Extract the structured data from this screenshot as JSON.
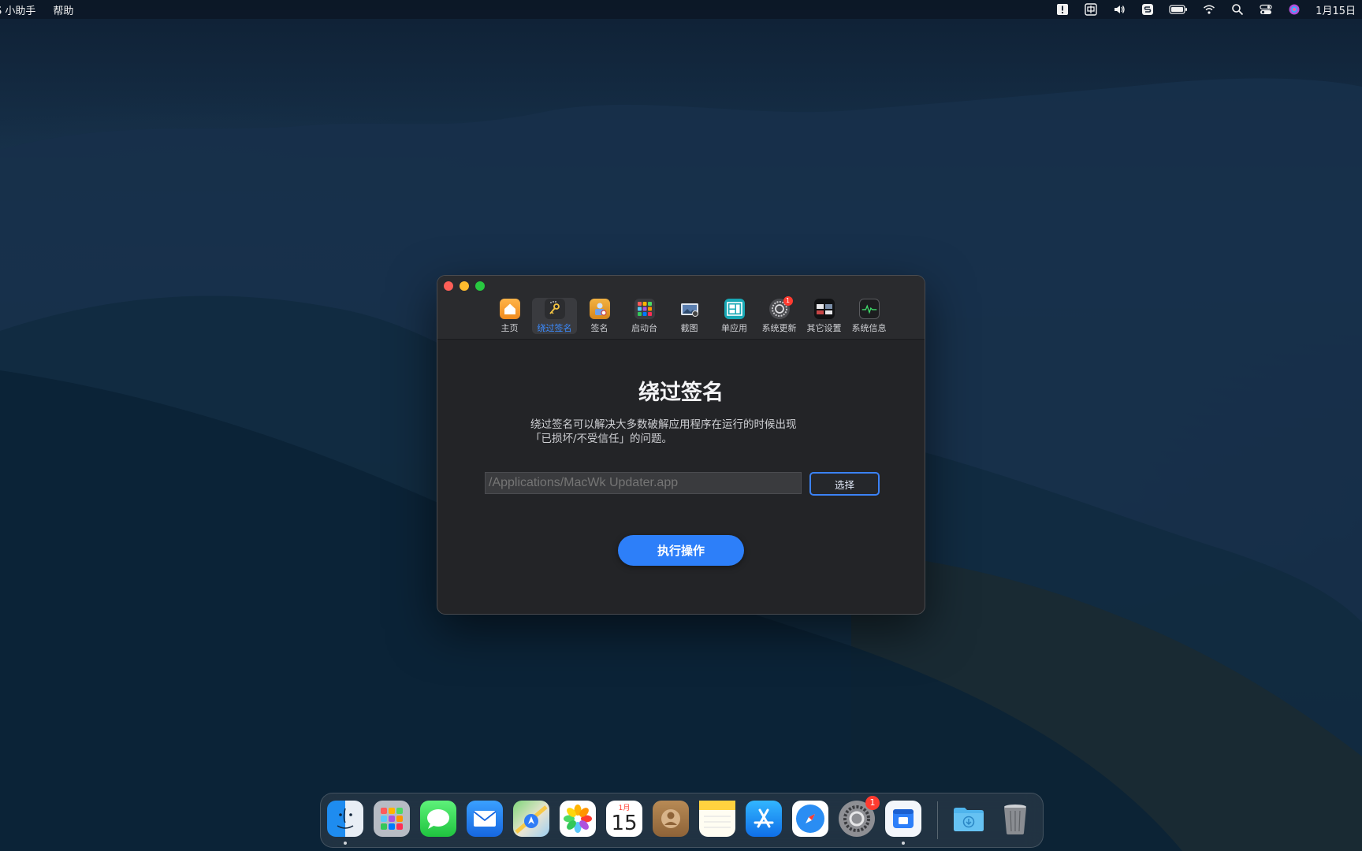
{
  "menubar": {
    "app_name": "S 小助手",
    "help": "帮助",
    "clock": "1月15日"
  },
  "window": {
    "tabs": [
      {
        "label": "主页",
        "icon": "home-icon"
      },
      {
        "label": "绕过签名",
        "icon": "key-wand-icon",
        "active": true
      },
      {
        "label": "签名",
        "icon": "signature-icon"
      },
      {
        "label": "启动台",
        "icon": "launchpad-icon"
      },
      {
        "label": "截图",
        "icon": "screenshot-icon"
      },
      {
        "label": "单应用",
        "icon": "single-app-icon"
      },
      {
        "label": "系统更新",
        "icon": "system-update-icon",
        "badge": "1"
      },
      {
        "label": "其它设置",
        "icon": "other-settings-icon"
      },
      {
        "label": "系统信息",
        "icon": "system-info-icon"
      }
    ],
    "title": "绕过签名",
    "description_line1": "绕过签名可以解决大多数破解应用程序在运行的时候出现",
    "description_line2": "「已损坏/不受信任」的问题。",
    "path_placeholder": "/Applications/MacWk Updater.app",
    "choose_label": "选择",
    "execute_label": "执行操作"
  },
  "dock": {
    "items": [
      "Finder",
      "Launchpad",
      "Messages",
      "Mail",
      "Maps",
      "Photos",
      "Calendar",
      "Contacts",
      "Notes",
      "App Store",
      "Safari",
      "System Preferences",
      "Helper",
      "Downloads",
      "Trash"
    ],
    "calendar_month": "1月",
    "calendar_day": "15",
    "system_prefs_badge": "1"
  },
  "colors": {
    "accent": "#2d7ff9",
    "badge": "#ff3b30"
  }
}
